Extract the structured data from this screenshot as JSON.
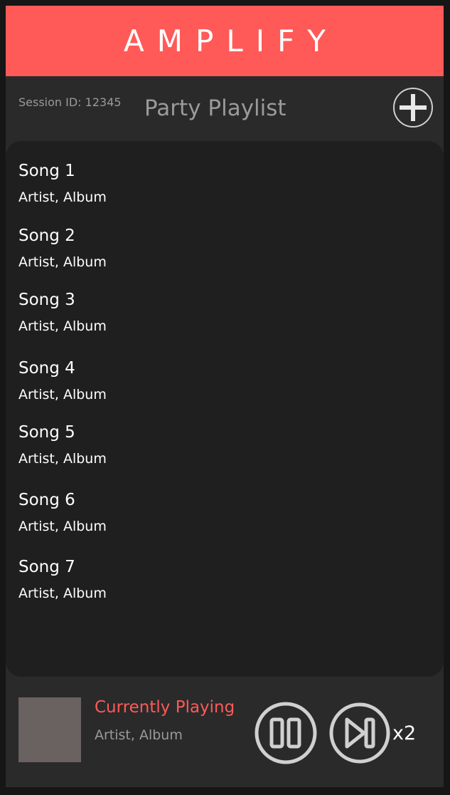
{
  "app": {
    "title": "AMPLIFY"
  },
  "session": {
    "label": "Session ID: 12345"
  },
  "playlist": {
    "title": "Party Playlist"
  },
  "songs": [
    {
      "title": "Song 1",
      "subtitle": "Artist, Album"
    },
    {
      "title": "Song 2",
      "subtitle": "Artist, Album"
    },
    {
      "title": "Song 3",
      "subtitle": "Artist, Album"
    },
    {
      "title": "Song 4",
      "subtitle": "Artist, Album"
    },
    {
      "title": "Song 5",
      "subtitle": "Artist, Album"
    },
    {
      "title": "Song 6",
      "subtitle": "Artist, Album"
    },
    {
      "title": "Song 7",
      "subtitle": "Artist, Album"
    }
  ],
  "now_playing": {
    "title": "Currently Playing",
    "subtitle": "Artist, Album",
    "skip_count": "x2"
  },
  "icons": {
    "add": "plus-circle-icon",
    "pause": "pause-circle-icon",
    "skip": "skip-next-circle-icon"
  },
  "colors": {
    "accent": "#ff5a57",
    "background": "#2a2a2a",
    "list_background": "#1f1f1f",
    "muted_text": "#9a9a9a",
    "album_art": "#6a6161"
  }
}
